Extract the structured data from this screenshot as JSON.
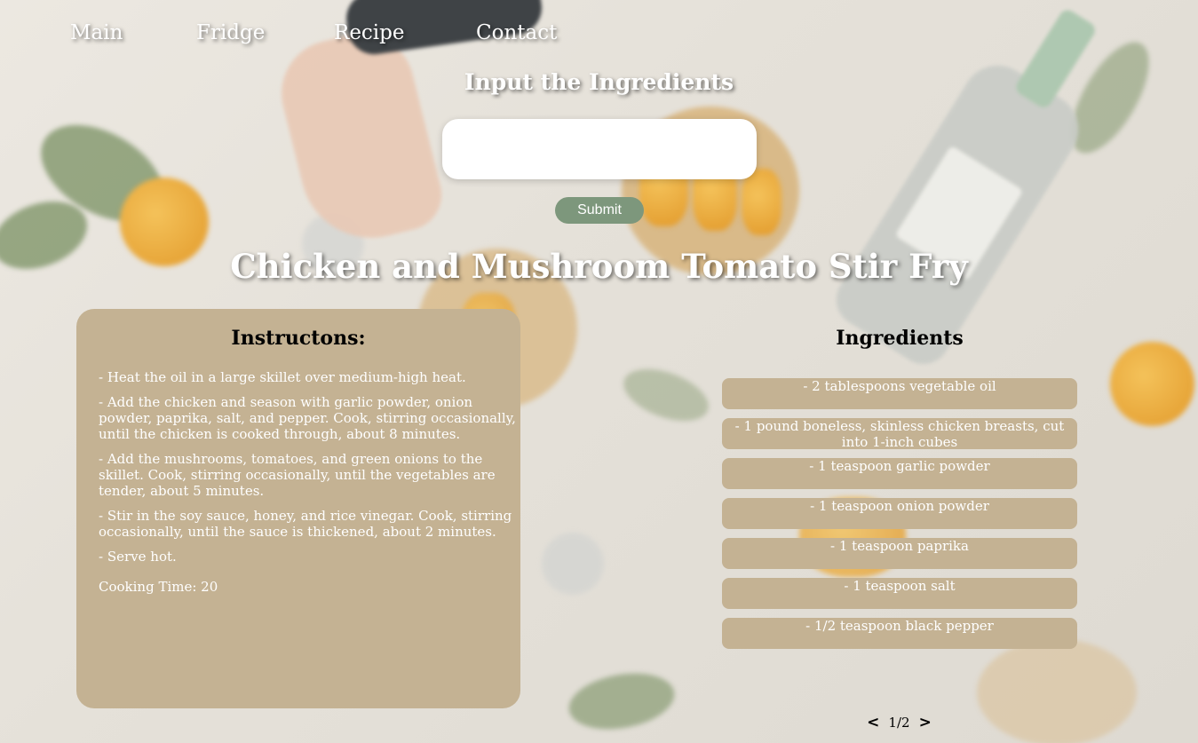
{
  "nav": {
    "items": [
      {
        "label": "Main"
      },
      {
        "label": "Fridge"
      },
      {
        "label": "Recipe"
      },
      {
        "label": "Contact"
      }
    ]
  },
  "search": {
    "title": "Input the Ingredients",
    "value": "",
    "submit_label": "Submit"
  },
  "recipe": {
    "title": "Chicken and Mushroom Tomato Stir Fry",
    "instructions_heading": "Instructons:",
    "steps": [
      "- Heat the oil in a large skillet over medium-high heat.",
      "- Add the chicken and season with garlic powder, onion powder, paprika, salt, and pepper. Cook, stirring occasionally, until the chicken is cooked through, about 8 minutes.",
      "- Add the mushrooms, tomatoes, and green onions to the skillet. Cook, stirring occasionally, until the vegetables are tender, about 5 minutes.",
      "- Stir in the soy sauce, honey, and rice vinegar. Cook, stirring occasionally, until the sauce is thickened, about 2 minutes.",
      "- Serve hot."
    ],
    "cooking_time": "Cooking Time: 20",
    "ingredients_heading": "Ingredients",
    "ingredients": [
      "- 2 tablespoons vegetable oil",
      "- 1 pound boneless, skinless chicken breasts, cut into 1-inch cubes",
      "- 1 teaspoon garlic powder",
      "- 1 teaspoon onion powder",
      "- 1 teaspoon paprika",
      "- 1 teaspoon salt",
      "- 1/2 teaspoon black pepper"
    ]
  },
  "pager": {
    "prev_label": "<",
    "indicator": "1/2",
    "next_label": ">"
  },
  "colors": {
    "card": "#c4b293",
    "submit": "#7d977c",
    "heading_text": "#ffffff"
  }
}
